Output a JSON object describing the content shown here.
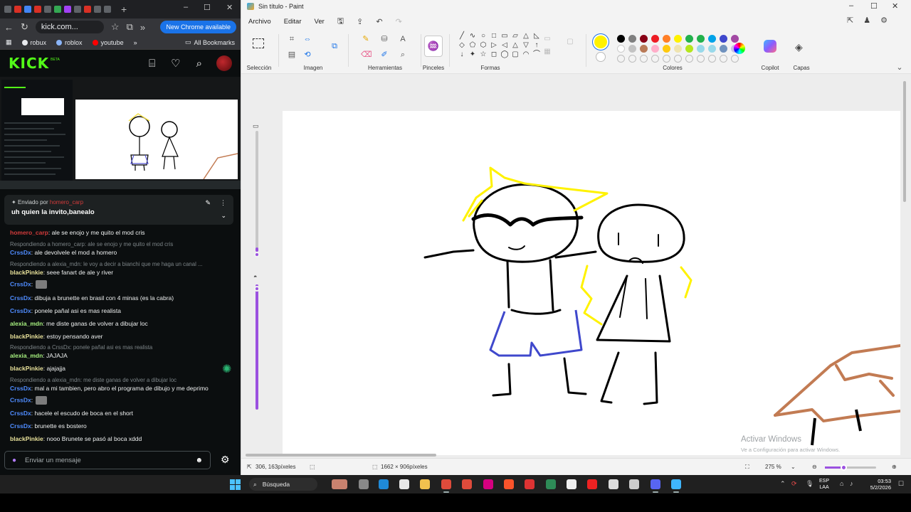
{
  "browser": {
    "url": "kick.com...",
    "update_label": "New Chrome available",
    "bookmarks": [
      "robux",
      "roblox",
      "youtube"
    ],
    "all_bookmarks": "All Bookmarks"
  },
  "kick": {
    "logo": "KICK",
    "logo_badge": "BETA"
  },
  "chat": {
    "pinned_by_label": "Enviado por",
    "pinned_by_user": "homero_carp",
    "pinned_message": "uh quien la invito,banealo",
    "messages": [
      {
        "type": "msg",
        "user": "homero_carp",
        "color": "#d33b3b",
        "text": ": ale se enojo y me quito el mod cris"
      },
      {
        "type": "reply",
        "text": "Respondiendo a homero_carp: ale se enojo y me quito el mod cris"
      },
      {
        "type": "msg",
        "user": "CrssDx",
        "color": "#4f8cff",
        "text": ": ale devolvele el mod a homero"
      },
      {
        "type": "reply",
        "text": "Respondiendo a alexia_mdn: le voy a decir a bianchi que me haga un canal ..."
      },
      {
        "type": "msg",
        "user": "blackPinkie",
        "color": "#e8e19a",
        "text": ": seee fanart de ale y river"
      },
      {
        "type": "emote",
        "user": "CrssDx",
        "color": "#4f8cff",
        "text": ":"
      },
      {
        "type": "msg",
        "user": "CrssDx",
        "color": "#4f8cff",
        "text": ": dibuja a brunette en brasil con 4 minas (es la cabra)"
      },
      {
        "type": "msg",
        "user": "CrssDx",
        "color": "#4f8cff",
        "text": ": ponele pañal asi es mas realista"
      },
      {
        "type": "msg",
        "user": "alexia_mdn",
        "color": "#a6f07f",
        "text": ": me diste ganas de volver a dibujar loc"
      },
      {
        "type": "msg",
        "user": "blackPinkie",
        "color": "#e8e19a",
        "text": ": estoy pensando aver"
      },
      {
        "type": "reply",
        "text": "Respondiendo a CrssDx: ponele pañal asi es mas realista"
      },
      {
        "type": "msg",
        "user": "alexia_mdn",
        "color": "#a6f07f",
        "text": ": JAJAJA"
      },
      {
        "type": "msg",
        "user": "blackPinkie",
        "color": "#e8e19a",
        "text": ": ajajajja"
      },
      {
        "type": "reply",
        "text": "Respondiendo a alexia_mdn: me diste ganas de volver a dibujar loc"
      },
      {
        "type": "msg",
        "user": "CrssDx",
        "color": "#4f8cff",
        "text": ": mal a mi tambien, pero abro el programa de dibujo y me deprimo"
      },
      {
        "type": "emote",
        "user": "CrssDx",
        "color": "#4f8cff",
        "text": ":"
      },
      {
        "type": "msg",
        "user": "CrssDx",
        "color": "#4f8cff",
        "text": ": hacele el escudo de boca en el short"
      },
      {
        "type": "msg",
        "user": "CrssDx",
        "color": "#4f8cff",
        "text": ": brunette es bostero"
      },
      {
        "type": "msg",
        "user": "blackPinkie",
        "color": "#e8e19a",
        "text": ": nooo Brunete se pasó al boca xddd"
      }
    ],
    "input_placeholder": "Enviar un mensaje"
  },
  "paint": {
    "title": "Sin título - Paint",
    "menu": [
      "Archivo",
      "Editar",
      "Ver"
    ],
    "groups": [
      "Selección",
      "Imagen",
      "Herramientas",
      "Pinceles",
      "Formas",
      "Colores",
      "Copilot",
      "Capas"
    ],
    "primary_color": "#fff200",
    "secondary_color": "#ffffff",
    "palette_row1": [
      "#000000",
      "#7f7f7f",
      "#880015",
      "#ed1c24",
      "#ff7f27",
      "#fff200",
      "#22b14c",
      "#22b14c",
      "#00a2e8",
      "#3f48cc",
      "#a349a4"
    ],
    "palette_row2": [
      "#ffffff",
      "#c3c3c3",
      "#b97a57",
      "#ffaec9",
      "#ffc90e",
      "#efe4b0",
      "#b5e61d",
      "#99d9ea",
      "#99d9ea",
      "#7092be",
      "#c8bfe7"
    ],
    "status_cursor": "306, 163píxeles",
    "status_size": "1662 × 906píxeles",
    "zoom": "275 %",
    "watermark_title": "Activar Windows",
    "watermark_sub": "Ve a Configuración para activar Windows."
  },
  "taskbar": {
    "search_label": "Búsqueda",
    "lang_top": "ESP",
    "lang_bottom": "LAA",
    "time": "03:53",
    "date": "5/2/2026"
  }
}
